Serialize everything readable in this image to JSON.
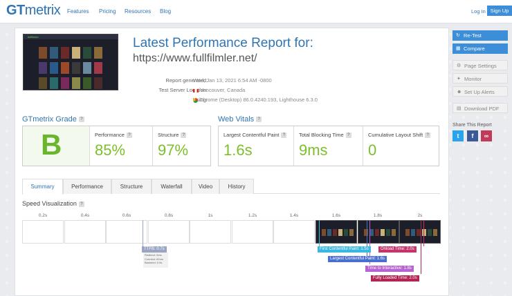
{
  "header": {
    "logo_gt": "GT",
    "logo_metrix": "metrix",
    "nav": [
      "Features",
      "Pricing",
      "Resources",
      "Blog"
    ],
    "login": "Log In",
    "signup": "Sign Up"
  },
  "report": {
    "title": "Latest Performance Report for:",
    "url": "https://www.fullfilmler.net/",
    "thumbnail_brand": "fullfilmler",
    "meta": [
      {
        "label": "Report generated:",
        "value": "Wed, Jan 13, 2021 6:54 AM -0800"
      },
      {
        "label": "Test Server Location:",
        "value": "Vancouver, Canada"
      },
      {
        "label": "Using:",
        "value": "Chrome (Desktop) 86.0.4240.193, Lighthouse 6.3.0"
      }
    ]
  },
  "grade": {
    "title": "GTmetrix Grade",
    "help": "?",
    "letter": "B",
    "performance_label": "Performance",
    "performance_value": "85%",
    "structure_label": "Structure",
    "structure_value": "97%"
  },
  "vitals": {
    "title": "Web Vitals",
    "help": "?",
    "lcp_label": "Largest Contentful Paint",
    "lcp_value": "1.6s",
    "tbt_label": "Total Blocking Time",
    "tbt_value": "9ms",
    "cls_label": "Cumulative Layout Shift",
    "cls_value": "0"
  },
  "tabs": [
    "Summary",
    "Performance",
    "Structure",
    "Waterfall",
    "Video",
    "History"
  ],
  "speed": {
    "title": "Speed Visualization",
    "ticks": [
      "0.2s",
      "0.4s",
      "0.6s",
      "0.8s",
      "1s",
      "1.2s",
      "1.4s",
      "1.6s",
      "1.8s",
      "2s"
    ],
    "ttfb": "TTFB: 0.7s",
    "ttfb_sub": [
      "Redirect: 0ms",
      "Connect: 62ms",
      "Backend: 0.5s"
    ],
    "fcp": "First Contentful Paint: 1.5s",
    "onload": "Onload Time: 2.0s",
    "lcp": "Largest Contentful Paint: 1.6s",
    "tti": "Time to Interactive: 1.8s",
    "flt": "Fully Loaded Time: 2.0s"
  },
  "sidebar": {
    "retest": "Re-Test",
    "compare": "Compare",
    "page_settings": "Page Settings",
    "monitor": "Monitor",
    "alerts": "Set Up Alerts",
    "download": "Download PDF",
    "share": "Share This Report"
  },
  "colors": {
    "accent": "#3d8ed8",
    "grade_green": "#6ab52e",
    "ttfb": "#9aa5c4",
    "fcp": "#3bb7e0",
    "lcp": "#4a6fd3",
    "tti": "#b764d0",
    "onload": "#c4356b",
    "flt": "#b12454"
  }
}
